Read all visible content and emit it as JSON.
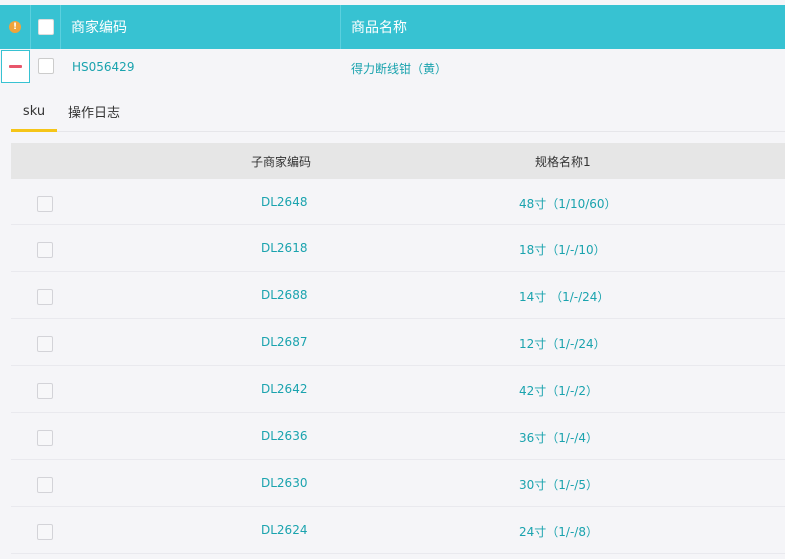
{
  "header": {
    "warn_icon": "!",
    "col_code": "商家编码",
    "col_name": "商品名称"
  },
  "product": {
    "code": "HS056429",
    "name": "得力断线钳（黄）"
  },
  "tabs": [
    {
      "label": "sku",
      "active": true
    },
    {
      "label": "操作日志",
      "active": false
    }
  ],
  "sku_table": {
    "col_code": "子商家编码",
    "col_spec": "规格名称1",
    "rows": [
      {
        "code": "DL2648",
        "spec": "48寸（1/10/60）"
      },
      {
        "code": "DL2618",
        "spec": "18寸（1/-/10）"
      },
      {
        "code": "DL2688",
        "spec": "14寸 （1/-/24）"
      },
      {
        "code": "DL2687",
        "spec": "12寸（1/-/24）"
      },
      {
        "code": "DL2642",
        "spec": "42寸（1/-/2）"
      },
      {
        "code": "DL2636",
        "spec": "36寸（1/-/4）"
      },
      {
        "code": "DL2630",
        "spec": "30寸（1/-/5）"
      },
      {
        "code": "DL2624",
        "spec": "24寸（1/-/8）"
      }
    ]
  },
  "colors": {
    "accent": "#37c2d2",
    "link": "#1aa3ae",
    "warn": "#f0a43c",
    "minus": "#e8566b",
    "tab_underline": "#f5c518"
  }
}
